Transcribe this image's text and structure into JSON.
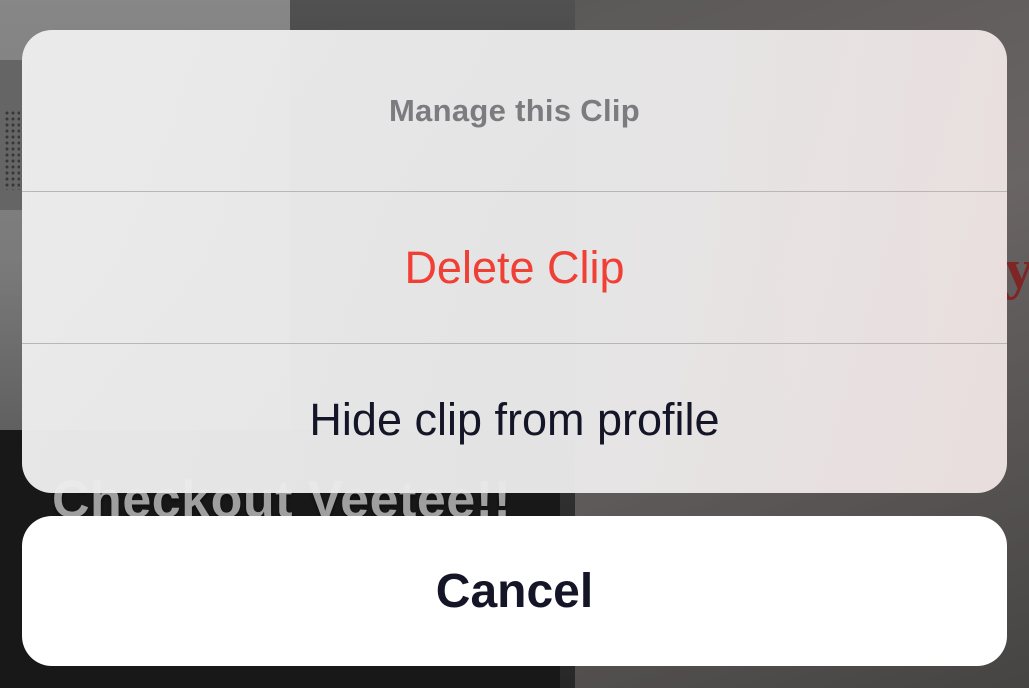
{
  "background": {
    "overlay_caption": "Checkout Veetee!!"
  },
  "action_sheet": {
    "title": "Manage this Clip",
    "actions": [
      {
        "label": "Delete Clip",
        "style": "destructive",
        "color": "#f03f35"
      },
      {
        "label": "Hide clip from profile",
        "style": "default",
        "color": "#141628"
      }
    ],
    "cancel_label": "Cancel"
  }
}
